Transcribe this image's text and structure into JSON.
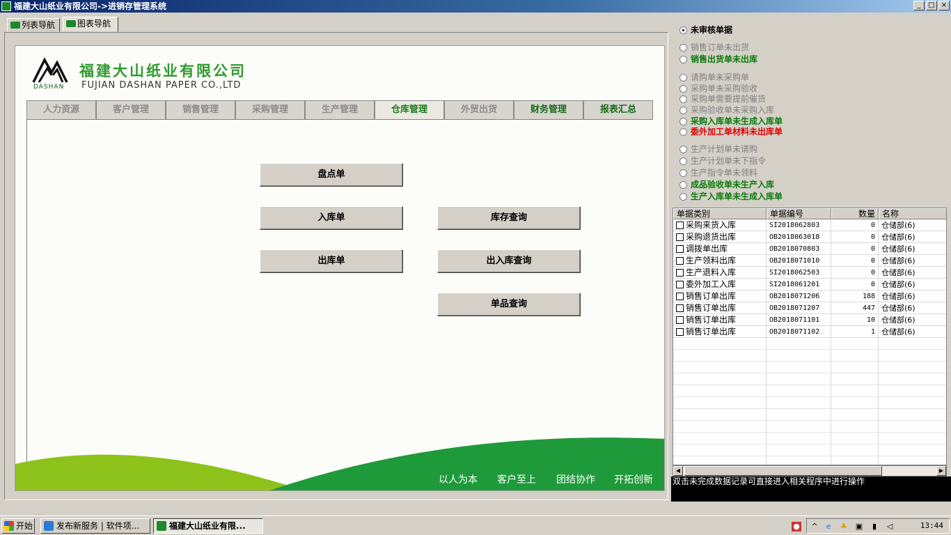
{
  "window": {
    "title": "福建大山纸业有限公司->进销存管理系统",
    "controls": [
      "_",
      "□",
      "×"
    ]
  },
  "nav_tabs": [
    {
      "label": "列表导航",
      "active": false
    },
    {
      "label": "图表导航",
      "active": true
    }
  ],
  "company": {
    "name_cn": "福建大山纸业有限公司",
    "name_en": "FUJIAN DASHAN PAPER CO.,LTD",
    "logo_text": "DASHAN",
    "brand_color": "#2e9a2e"
  },
  "module_tabs": [
    {
      "label": "人力资源",
      "state": "disabled"
    },
    {
      "label": "客户管理",
      "state": "disabled"
    },
    {
      "label": "销售管理",
      "state": "disabled"
    },
    {
      "label": "采购管理",
      "state": "disabled"
    },
    {
      "label": "生产管理",
      "state": "disabled"
    },
    {
      "label": "仓库管理",
      "state": "active"
    },
    {
      "label": "外贸出货",
      "state": "disabled"
    },
    {
      "label": "财务管理",
      "state": "enabled"
    },
    {
      "label": "报表汇总",
      "state": "enabled"
    }
  ],
  "actions": {
    "inventory_count": "盘点单",
    "stock_in": "入库单",
    "stock_out": "出库单",
    "inventory_query": "库存查询",
    "in_out_query": "出入库查询",
    "item_query": "单品查询"
  },
  "slogans": [
    "以人为本",
    "客户至上",
    "团结协作",
    "开拓创新"
  ],
  "filters": [
    {
      "label": "未审核单据",
      "style": "black",
      "checked": true
    },
    {
      "label": "销售订单未出货",
      "style": "grey",
      "checked": false
    },
    {
      "label": "销售出货单未出库",
      "style": "green",
      "checked": false
    },
    {
      "label": "请购单未采购单",
      "style": "grey",
      "checked": false
    },
    {
      "label": "采购单未采购验收",
      "style": "grey",
      "checked": false
    },
    {
      "label": "采购单需要提前催货",
      "style": "grey",
      "checked": false
    },
    {
      "label": "采购验收单未采购入库",
      "style": "grey",
      "checked": false
    },
    {
      "label": "采购入库单未生成入库单",
      "style": "green",
      "checked": false
    },
    {
      "label": "委外加工单材料未出库单",
      "style": "red",
      "checked": false
    },
    {
      "label": "生产计划单未请购",
      "style": "grey",
      "checked": false
    },
    {
      "label": "生产计划单未下指令",
      "style": "grey",
      "checked": false
    },
    {
      "label": "生产指令单未领料",
      "style": "grey",
      "checked": false
    },
    {
      "label": "成品验收单未生产入库",
      "style": "green",
      "checked": false
    },
    {
      "label": "生产入库单未生成入库单",
      "style": "green",
      "checked": false
    }
  ],
  "grid": {
    "columns": [
      "单据类别",
      "单据编号",
      "数量",
      "名称"
    ],
    "rows": [
      {
        "type": "采购来货入库",
        "code": "SI2018062803",
        "qty": "0",
        "name": "仓储部(6)"
      },
      {
        "type": "采购退货出库",
        "code": "OB2018063018",
        "qty": "0",
        "name": "仓储部(6)"
      },
      {
        "type": "调拨单出库",
        "code": "OB2018070803",
        "qty": "0",
        "name": "仓储部(6)"
      },
      {
        "type": "生产领料出库",
        "code": "OB2018071010",
        "qty": "0",
        "name": "仓储部(6)"
      },
      {
        "type": "生产退料入库",
        "code": "SI2018062503",
        "qty": "0",
        "name": "仓储部(6)"
      },
      {
        "type": "委外加工入库",
        "code": "SI2018061201",
        "qty": "0",
        "name": "仓储部(6)"
      },
      {
        "type": "销售订单出库",
        "code": "OB2018071206",
        "qty": "188",
        "name": "仓储部(6)"
      },
      {
        "type": "销售订单出库",
        "code": "OB2018071207",
        "qty": "447",
        "name": "仓储部(6)"
      },
      {
        "type": "销售订单出库",
        "code": "OB2018071101",
        "qty": "10",
        "name": "仓储部(6)"
      },
      {
        "type": "销售订单出库",
        "code": "OB2018071102",
        "qty": "1",
        "name": "仓储部(6)"
      }
    ]
  },
  "status_text": "双击未完成数据记录可直接进入相关程序中进行操作",
  "taskbar": {
    "start_label": "开始",
    "tasks": [
      {
        "label": "发布新服务 | 软件项...",
        "active": false
      },
      {
        "label": "福建大山纸业有限...",
        "active": true
      }
    ],
    "clock": "13:44"
  }
}
